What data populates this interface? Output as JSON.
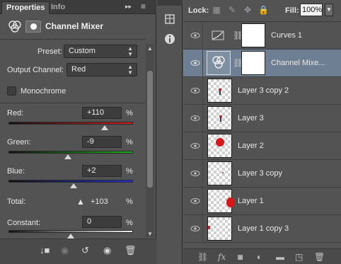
{
  "properties": {
    "tabs": [
      {
        "label": "Properties"
      },
      {
        "label": "Info"
      }
    ],
    "menu_controls": {
      "collapse": "▸▸",
      "menu": "≡"
    },
    "title": "Channel Mixer",
    "preset": {
      "label": "Preset:",
      "value": "Custom"
    },
    "output_channel": {
      "label": "Output Channel:",
      "value": "Red"
    },
    "monochrome": {
      "label": "Monochrome",
      "checked": false
    },
    "sliders": {
      "red": {
        "label": "Red:",
        "value": "+110",
        "unit": "%",
        "position_pct": 77
      },
      "green": {
        "label": "Green:",
        "value": "-9",
        "unit": "%",
        "position_pct": 48
      },
      "blue": {
        "label": "Blue:",
        "value": "+2",
        "unit": "%",
        "position_pct": 52
      }
    },
    "total": {
      "label": "Total:",
      "warning": "▲",
      "value": "+103",
      "unit": "%"
    },
    "constant": {
      "label": "Constant:",
      "value": "0",
      "unit": "%",
      "position_pct": 50
    },
    "bottom_icons": [
      "clip-to-layer-icon",
      "view-previous-icon",
      "reset-icon",
      "visibility-eye-icon",
      "trash-icon"
    ]
  },
  "tools": {
    "buttons": [
      {
        "name": "3d-cube-icon"
      },
      {
        "name": "info-icon"
      }
    ]
  },
  "layers": {
    "lock": {
      "label": "Lock:"
    },
    "fill": {
      "label": "Fill:",
      "value": "100%"
    },
    "items": [
      {
        "name": "Curves 1",
        "type": "adjustment",
        "selected": false
      },
      {
        "name": "Channel Mixe...",
        "type": "adjustment",
        "selected": true
      },
      {
        "name": "Layer 3 copy 2",
        "type": "pixel",
        "selected": false
      },
      {
        "name": "Layer 3",
        "type": "pixel",
        "selected": false
      },
      {
        "name": "Layer 2",
        "type": "pixel",
        "selected": false
      },
      {
        "name": "Layer 3 copy",
        "type": "pixel",
        "selected": false
      },
      {
        "name": "Layer 1",
        "type": "pixel",
        "selected": false
      },
      {
        "name": "Layer 1 copy 3",
        "type": "pixel",
        "selected": false
      }
    ],
    "bottom_icons": [
      "link-layers-icon",
      "fx-icon",
      "add-mask-icon",
      "new-adjustment-icon",
      "new-group-icon",
      "new-layer-icon",
      "delete-layer-icon"
    ]
  },
  "colors": {
    "panel_bg": "#535353",
    "selected_row": "#6e7f93",
    "red_slider": "#d02020",
    "green_slider": "#18b018",
    "blue_slider": "#2030d0"
  }
}
